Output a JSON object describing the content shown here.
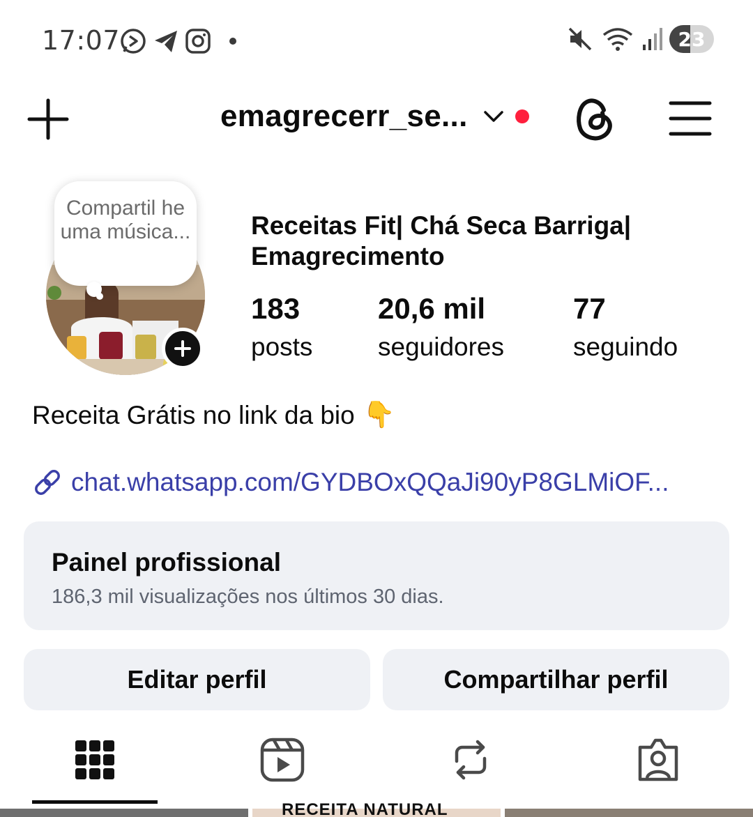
{
  "status_bar": {
    "time": "17:07",
    "battery": "23",
    "icons": [
      "whatsapp-status-icon",
      "telegram-icon",
      "instagram-icon",
      "dot-icon",
      "mute-icon",
      "wifi-icon",
      "signal-icon",
      "battery-icon"
    ]
  },
  "header": {
    "username": "emagrecerr_se...",
    "icons": [
      "plus-icon",
      "chevron-down-icon",
      "threads-icon",
      "menu-icon"
    ],
    "notification_color": "#ff1f3d"
  },
  "profile": {
    "note": "Compartil he uma música...",
    "display_name": "Receitas Fit| Chá Seca Barriga| Emagrecimento",
    "stats": [
      {
        "value": "183",
        "label": "posts"
      },
      {
        "value": "20,6 mil",
        "label": "seguidores"
      },
      {
        "value": "77",
        "label": "seguindo"
      }
    ],
    "bio": "Receita Grátis no link da bio",
    "bio_emoji": "👇",
    "link": "chat.whatsapp.com/GYDBOxQQaJi90yP8GLMiOF..."
  },
  "dashboard": {
    "title": "Painel profissional",
    "subtitle": "186,3 mil visualizações nos últimos 30 dias."
  },
  "actions": {
    "edit": "Editar perfil",
    "share": "Compartilhar perfil"
  },
  "tabs": [
    "grid-icon",
    "reels-icon",
    "reposts-icon",
    "tagged-icon"
  ],
  "grid_peek_text": "RECEITA NATURAL",
  "colors": {
    "link": "#3a3fa8",
    "panel_bg": "#eff1f5"
  }
}
